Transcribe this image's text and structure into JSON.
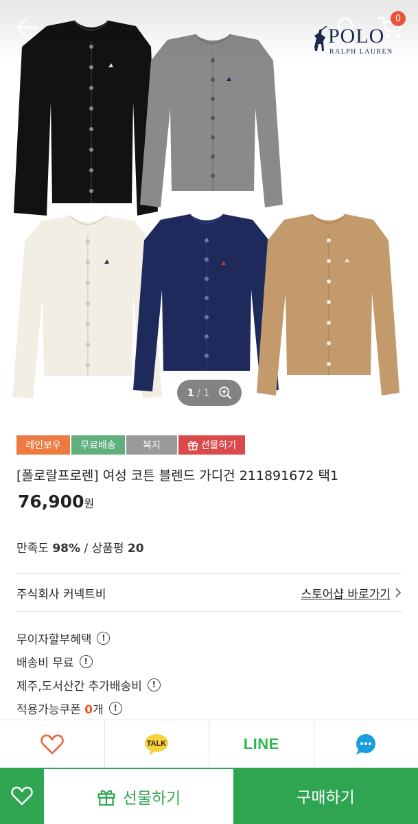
{
  "header": {
    "cart_count": "0",
    "brand_name": "POLO",
    "brand_sub": "RALPH LAUREN"
  },
  "gallery": {
    "current": "1",
    "separator": "/",
    "total": "1"
  },
  "colors": {
    "accent_green": "#2fa552",
    "sweater_black": "#121212",
    "sweater_gray": "#8a8a8a",
    "sweater_cream": "#f2eee4",
    "sweater_navy": "#1e2a5c",
    "sweater_camel": "#c29a6c"
  },
  "tags": {
    "rainbow": "레인보우",
    "free_shipping": "무료배송",
    "welfare": "복지",
    "gift": "선물하기"
  },
  "product": {
    "title": "[폴로랄프로렌] 여성 코튼 블렌드 가디건 211891672 택1",
    "price": "76,900",
    "price_unit": "원"
  },
  "rating": {
    "satisfaction_label": "만족도",
    "satisfaction_value": "98%",
    "separator": "/",
    "review_label": "상품평",
    "review_count": "20"
  },
  "store": {
    "name": "주식회사 커넥트비",
    "link_label": "스토어샵 바로가기"
  },
  "info": {
    "installment": "무이자할부혜택",
    "shipping": "배송비 무료",
    "extra_shipping": "제주,도서산간 추가배송비",
    "coupon_label": "적용가능쿠폰",
    "coupon_count": "0",
    "coupon_unit": "개"
  },
  "share": {
    "kakao_label": "TALK",
    "line_label": "LINE"
  },
  "bottom": {
    "gift_label": "선물하기",
    "buy_label": "구매하기"
  }
}
